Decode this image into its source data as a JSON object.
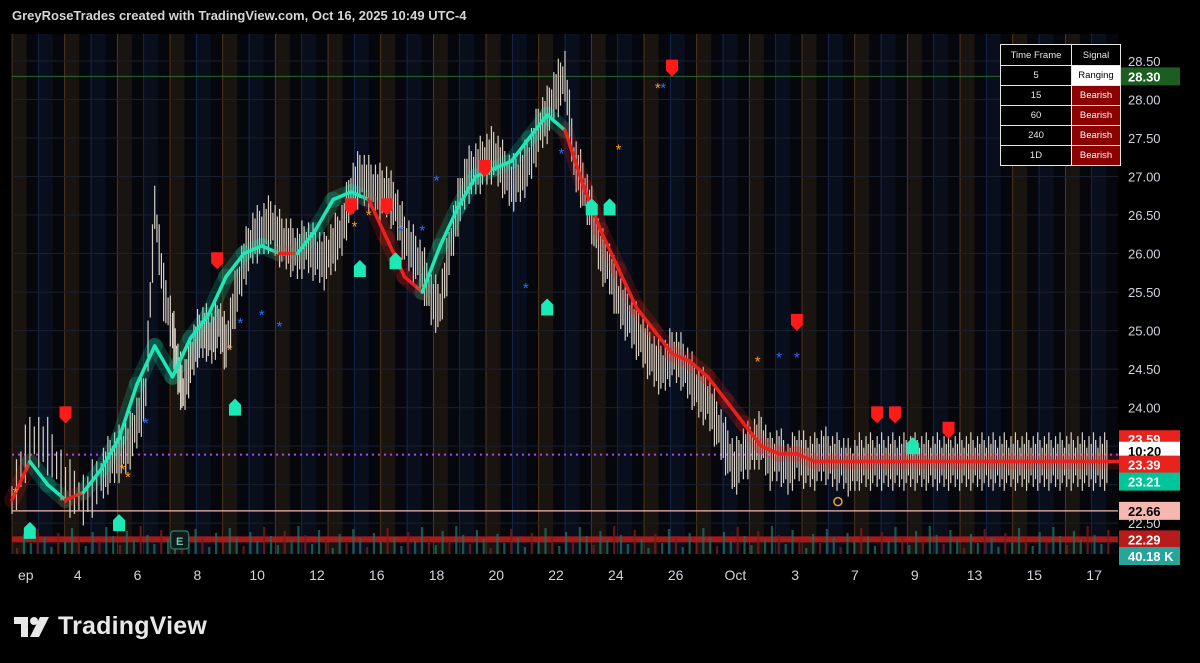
{
  "header": {
    "title": "GreyRoseTrades created with TradingView.com, Oct 16, 2025 10:49 UTC-4"
  },
  "brand": {
    "name": "TradingView"
  },
  "colors": {
    "bull": "#1de9b6",
    "bear": "#e8221c",
    "bull_marker": "#1de9b6",
    "bear_marker": "#ff1a1a",
    "blue_star": "#2b6cff",
    "orange_star": "#ff9a1f",
    "grid_orange": "#f39c3c",
    "grid_blue": "#3a6fd8",
    "support": "#b71c1c",
    "vwap": "#b044f5"
  },
  "chart_data": {
    "type": "line",
    "x_axis_labels": [
      "ep",
      "4",
      "6",
      "8",
      "10",
      "12",
      "16",
      "18",
      "20",
      "22",
      "24",
      "26",
      "Oct",
      "3",
      "7",
      "9",
      "13",
      "15",
      "17"
    ],
    "y_ticks": [
      22.5,
      23.0,
      23.5,
      24.0,
      24.5,
      25.0,
      25.5,
      26.0,
      26.5,
      27.0,
      27.5,
      28.0,
      28.5
    ],
    "y_tick_labels": [
      "22.50",
      "23.00",
      "23.50",
      "24.00",
      "24.50",
      "25.00",
      "25.50",
      "26.00",
      "26.50",
      "27.00",
      "27.50",
      "28.00",
      "28.50"
    ],
    "ylim": [
      22.1,
      28.85
    ],
    "price_series": {
      "x": [
        0,
        1,
        2,
        3,
        4,
        5,
        5.5,
        6,
        6.5,
        7,
        7.5,
        8,
        8.5,
        9,
        9.3,
        9.6,
        10,
        10.4,
        10.8,
        11.2,
        11.6,
        12,
        12.5,
        13,
        13.5,
        14,
        14.5,
        15,
        15.5,
        16,
        16.5,
        17,
        17.5,
        18,
        18.5,
        19,
        19.5,
        20,
        20.5,
        21,
        21.5,
        22,
        22.5,
        23,
        23.5,
        24,
        24.5,
        25,
        25.5,
        26,
        26.5,
        27,
        27.5,
        28,
        28.5,
        29,
        29.5,
        30,
        30.5,
        31,
        31.5,
        32,
        32.5,
        33,
        33.5,
        34,
        34.5,
        35,
        35.5,
        36,
        36.5,
        37,
        37.5,
        38,
        38.5,
        39,
        39.5,
        40,
        40.5,
        41,
        41.5,
        42,
        42.5,
        43,
        43.5,
        44,
        44.5,
        45,
        45.5,
        46,
        46.5,
        47,
        47.5,
        48,
        48.5,
        49,
        49.5,
        50,
        50.5,
        51,
        51.5,
        52,
        52.5,
        53,
        53.5,
        54,
        54.5,
        55,
        55.5,
        56,
        56.5,
        57,
        57.5,
        58,
        58.5,
        59,
        59.5,
        60,
        60.5,
        61,
        61.5,
        62
      ],
      "y": [
        22.8,
        23.6,
        23.5,
        23.0,
        22.8,
        23.1,
        23.3,
        23.4,
        23.5,
        23.8,
        24.2,
        26.6,
        25.5,
        25.0,
        24.5,
        24.2,
        24.6,
        24.9,
        25.0,
        24.9,
        25.1,
        24.8,
        25.4,
        25.9,
        26.2,
        26.3,
        26.4,
        26.2,
        26.1,
        26.0,
        26.1,
        26.0,
        25.9,
        26.1,
        26.3,
        26.8,
        27.0,
        26.9,
        26.8,
        26.8,
        26.6,
        26.2,
        26.0,
        25.8,
        25.4,
        25.3,
        26.0,
        26.6,
        27.0,
        27.1,
        27.2,
        27.3,
        27.1,
        26.9,
        27.0,
        27.2,
        27.6,
        27.8,
        28.1,
        28.3,
        27.2,
        26.9,
        26.5,
        26.0,
        25.8,
        25.4,
        25.2,
        25.0,
        24.8,
        24.6,
        24.5,
        24.7,
        24.6,
        24.4,
        24.2,
        24.1,
        23.8,
        23.5,
        23.2,
        23.4,
        23.5,
        23.6,
        23.3,
        23.4,
        23.2,
        23.4,
        23.3,
        23.3,
        23.4,
        23.3,
        23.3,
        23.2,
        23.3,
        23.3,
        23.3,
        23.3,
        23.3,
        23.3,
        23.3,
        23.3,
        23.3,
        23.3,
        23.3,
        23.3,
        23.3,
        23.3,
        23.3,
        23.3,
        23.3,
        23.3,
        23.3,
        23.3,
        23.3,
        23.3,
        23.3,
        23.3,
        23.3,
        23.3,
        23.3,
        23.3,
        23.3
      ]
    },
    "trend_series": {
      "x": [
        0,
        1,
        2,
        3,
        4,
        5,
        6,
        7,
        8,
        9,
        10,
        11,
        12,
        13,
        14,
        15,
        16,
        17,
        18,
        19,
        20,
        21,
        22,
        23,
        24,
        25,
        26,
        27,
        28,
        29,
        30,
        31,
        32,
        33,
        34,
        35,
        36,
        37,
        38,
        39,
        40,
        41,
        42,
        43,
        44,
        45,
        46,
        47,
        48,
        49,
        50,
        51,
        52,
        53,
        54,
        55,
        56,
        57,
        58,
        59,
        60,
        61,
        62
      ],
      "y": [
        22.8,
        23.3,
        23.0,
        22.8,
        22.9,
        23.2,
        23.6,
        24.3,
        24.8,
        24.4,
        24.9,
        25.2,
        25.7,
        26.0,
        26.1,
        26.0,
        26.0,
        26.3,
        26.7,
        26.8,
        26.7,
        26.2,
        25.7,
        25.5,
        26.1,
        26.6,
        27.0,
        27.1,
        27.2,
        27.5,
        27.8,
        27.6,
        26.9,
        26.3,
        25.8,
        25.3,
        25.0,
        24.7,
        24.6,
        24.4,
        24.1,
        23.8,
        23.5,
        23.4,
        23.4,
        23.3,
        23.3,
        23.3,
        23.3,
        23.3,
        23.3,
        23.3,
        23.3,
        23.3,
        23.3,
        23.3,
        23.3,
        23.3,
        23.3,
        23.3,
        23.3,
        23.3,
        23.3
      ],
      "bull_segments": [
        [
          1,
          2
        ],
        [
          4,
          14
        ],
        [
          16,
          19
        ],
        [
          23,
          30
        ]
      ]
    },
    "bull_markers_y": [
      22.4,
      24.0,
      22.5,
      25.8,
      25.9,
      25.3,
      26.6,
      26.6,
      23.5
    ],
    "bear_markers_y": [
      23.9,
      25.9,
      26.6,
      26.6,
      27.1,
      28.4,
      25.1,
      23.9,
      23.9,
      23.7
    ],
    "price_labels": [
      {
        "value": "28.30",
        "bg": "#1b5e20",
        "fg": "#ffffff"
      },
      {
        "value": "23.59",
        "bg": "#e8221c",
        "fg": "#ffffff"
      },
      {
        "value": "10:20",
        "bg": "#ffffff",
        "fg": "#000000"
      },
      {
        "value": "23.39",
        "bg": "#e8221c",
        "fg": "#ffffff"
      },
      {
        "value": "23.21",
        "bg": "#00c49a",
        "fg": "#ffffff"
      },
      {
        "value": "22.66",
        "bg": "#f4b8b0",
        "fg": "#000000"
      },
      {
        "value": "22.29",
        "bg": "#b71c1c",
        "fg": "#ffffff"
      },
      {
        "value": "40.18 K",
        "bg": "#26a69a",
        "fg": "#ffffff"
      }
    ],
    "earnings_badge": "E"
  },
  "signal_table": {
    "headers": [
      "Time Frame",
      "Signal"
    ],
    "rows": [
      {
        "tf": "5",
        "signal": "Ranging",
        "bg": "#ffffff",
        "fg": "#000000"
      },
      {
        "tf": "15",
        "signal": "Bearish",
        "bg": "#8b0000",
        "fg": "#ffffff"
      },
      {
        "tf": "60",
        "signal": "Bearish",
        "bg": "#8b0000",
        "fg": "#ffffff"
      },
      {
        "tf": "240",
        "signal": "Bearish",
        "bg": "#8b0000",
        "fg": "#ffffff"
      },
      {
        "tf": "1D",
        "signal": "Bearish",
        "bg": "#8b0000",
        "fg": "#ffffff"
      }
    ]
  }
}
